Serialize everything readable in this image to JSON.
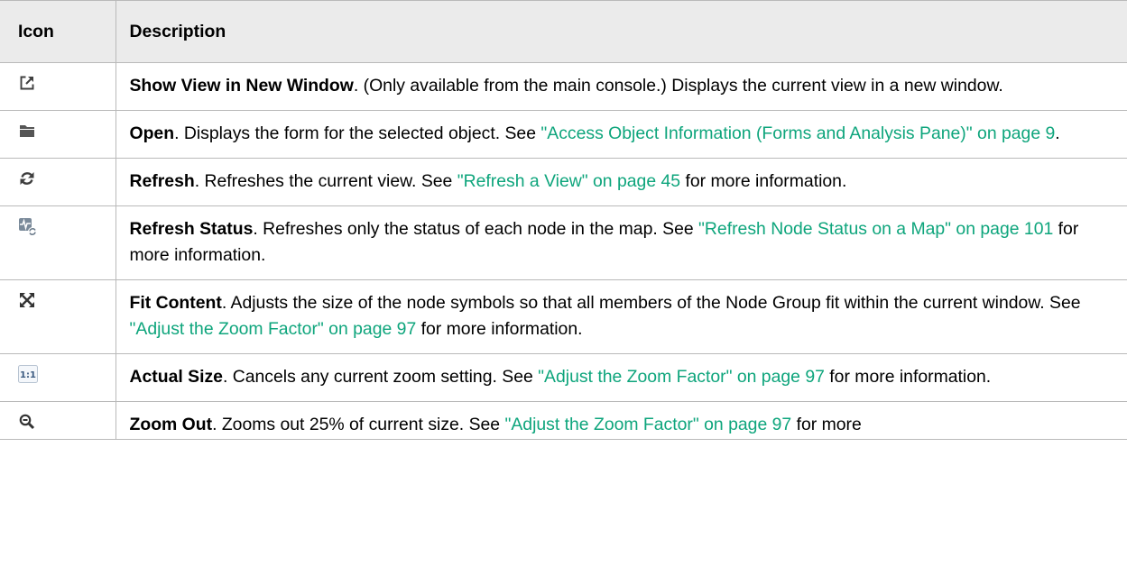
{
  "table": {
    "headers": {
      "icon": "Icon",
      "description": "Description"
    },
    "rows": [
      {
        "icon": "new-window-icon",
        "term": "Show View in New Window",
        "text_before": ". (Only available from the main console.) Displays the current view in a new window.",
        "link": "",
        "text_after": ""
      },
      {
        "icon": "folder-open-icon",
        "term": "Open",
        "text_before": ". Displays the form for the selected object. See ",
        "link": "\"Access Object Information (Forms and Analysis Pane)\" on page 9",
        "text_after": "."
      },
      {
        "icon": "refresh-icon",
        "term": "Refresh",
        "text_before": ". Refreshes the current view. See ",
        "link": "\"Refresh a View\" on page 45",
        "text_after": " for more information."
      },
      {
        "icon": "refresh-status-icon",
        "term": "Refresh Status",
        "text_before": ". Refreshes only the status of each node in the map. See ",
        "link": "\"Refresh Node Status on a Map\" on page 101",
        "text_after": " for more information."
      },
      {
        "icon": "fit-content-icon",
        "term": "Fit Content",
        "text_before": ". Adjusts the size of the node symbols so that all members of the Node Group fit within the current window. See ",
        "link": "\"Adjust the Zoom Factor\" on page 97",
        "text_after": " for more information."
      },
      {
        "icon": "actual-size-icon",
        "icon_text": "1:1",
        "term": "Actual Size",
        "text_before": ". Cancels any current zoom setting. See ",
        "link": "\"Adjust the Zoom Factor\" on page 97",
        "text_after": " for more information."
      },
      {
        "icon": "zoom-out-icon",
        "term": "Zoom Out",
        "text_before": ". Zooms out 25% of current size. See ",
        "link": "\"Adjust the Zoom Factor\" on page 97",
        "text_after": " for more"
      }
    ]
  },
  "colors": {
    "header_bg": "#ebebeb",
    "border": "#b9b9b9",
    "link": "#0ea57c",
    "icon_dark": "#3f3f3f"
  }
}
